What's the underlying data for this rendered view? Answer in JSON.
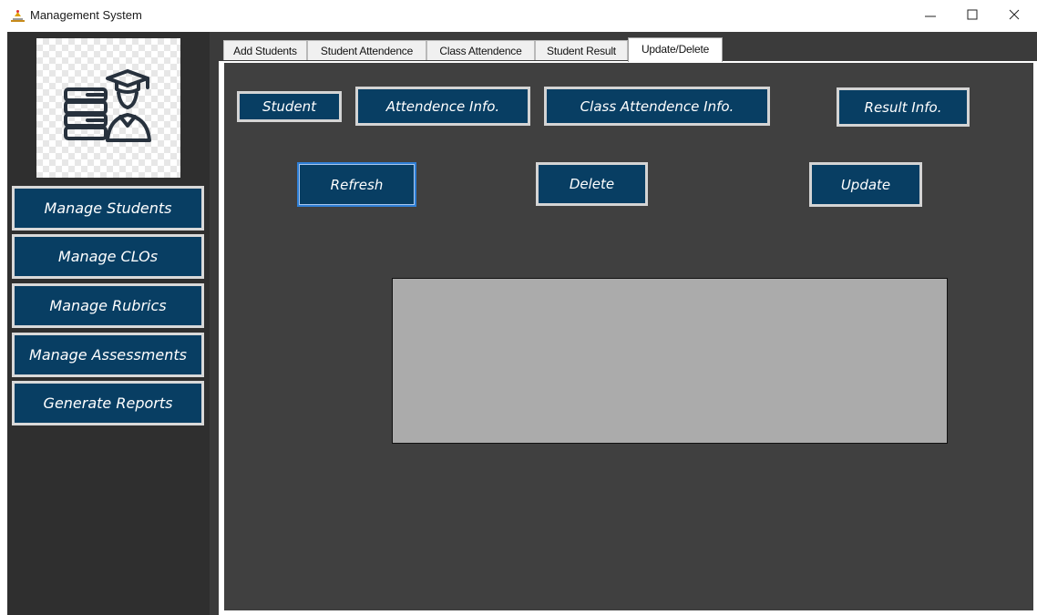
{
  "window": {
    "title": "Management System",
    "icon": "app-icon",
    "controls": {
      "minimize": "—",
      "maximize": "☐",
      "close": "✕"
    }
  },
  "sidebar": {
    "logo": "books-graduate-icon",
    "items": [
      {
        "label": "Manage Students"
      },
      {
        "label": "Manage CLOs"
      },
      {
        "label": "Manage Rubrics"
      },
      {
        "label": "Manage Assessments"
      },
      {
        "label": "Generate Reports"
      }
    ]
  },
  "tabs": [
    {
      "label": "Add Students",
      "active": false
    },
    {
      "label": "Student Attendence",
      "active": false
    },
    {
      "label": "Class Attendence",
      "active": false
    },
    {
      "label": "Student Result",
      "active": false
    },
    {
      "label": "Update/Delete",
      "active": true
    }
  ],
  "panel": {
    "view_buttons": {
      "student": "Student",
      "attendence_info": "Attendence Info.",
      "class_attendence_info": "Class Attendence Info.",
      "result_info": "Result Info."
    },
    "actions": {
      "refresh": "Refresh",
      "delete": "Delete",
      "update": "Update"
    }
  },
  "colors": {
    "button_bg": "#083e63",
    "panel_bg": "#404040",
    "sidebar_bg": "#2f2f2f",
    "grid_bg": "#ababab",
    "focus_border": "#2f7fd6"
  }
}
